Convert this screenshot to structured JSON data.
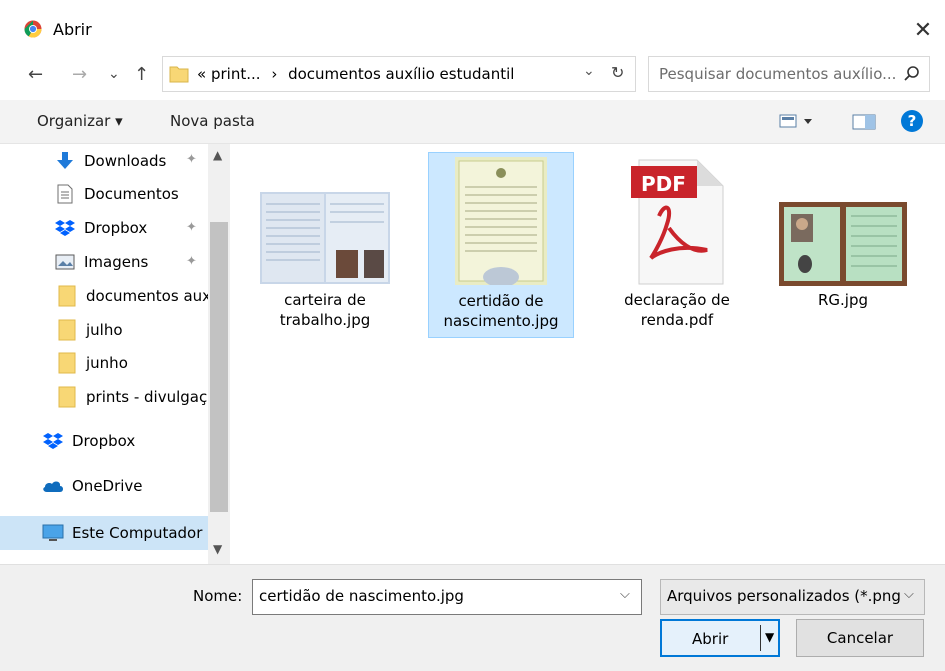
{
  "window": {
    "title": "Abrir",
    "close": "✕"
  },
  "nav": {
    "back": "←",
    "forward": "→",
    "recent": "⌄",
    "up": "↑"
  },
  "address": {
    "prefix": "«",
    "path1": "print...",
    "sep": "›",
    "path2": "documentos auxílio estudantil",
    "dropdown": "⌄",
    "refresh": "↻"
  },
  "search": {
    "placeholder": "Pesquisar documentos auxílio..."
  },
  "toolbar": {
    "organize": "Organizar ▾",
    "new_folder": "Nova pasta",
    "help": "?"
  },
  "sidebar": {
    "items": [
      {
        "label": "Downloads",
        "icon": "download-icon",
        "pinned": true
      },
      {
        "label": "Documentos",
        "icon": "document-icon",
        "pinned": true
      },
      {
        "label": "Dropbox",
        "icon": "dropbox-icon",
        "pinned": true
      },
      {
        "label": "Imagens",
        "icon": "image-icon",
        "pinned": true
      },
      {
        "label": "documentos aux",
        "icon": "folder-icon",
        "pinned": false
      },
      {
        "label": "julho",
        "icon": "folder-icon",
        "pinned": false
      },
      {
        "label": "junho",
        "icon": "folder-icon",
        "pinned": false
      },
      {
        "label": "prints - divulgaç",
        "icon": "folder-icon",
        "pinned": false
      },
      {
        "label": "Dropbox",
        "icon": "dropbox-icon",
        "pinned": false
      },
      {
        "label": "OneDrive",
        "icon": "onedrive-icon",
        "pinned": false
      },
      {
        "label": "Este Computador",
        "icon": "computer-icon",
        "pinned": false
      }
    ]
  },
  "files": [
    {
      "line1": "carteira de",
      "line2": "trabalho.jpg",
      "selected": false
    },
    {
      "line1": "certidão de",
      "line2": "nascimento.jpg",
      "selected": true
    },
    {
      "line1": "declaração de",
      "line2": "renda.pdf",
      "selected": false
    },
    {
      "line1": "RG.jpg",
      "line2": "",
      "selected": false
    }
  ],
  "pdf_badge": "PDF",
  "bottom": {
    "name_label": "Nome:",
    "name_value": "certidão de nascimento.jpg",
    "filter": "Arquivos personalizados (*.png",
    "open": "Abrir",
    "cancel": "Cancelar"
  },
  "colors": {
    "accent": "#0078d7",
    "selection": "#cce8ff",
    "folder": "#f8d775"
  }
}
